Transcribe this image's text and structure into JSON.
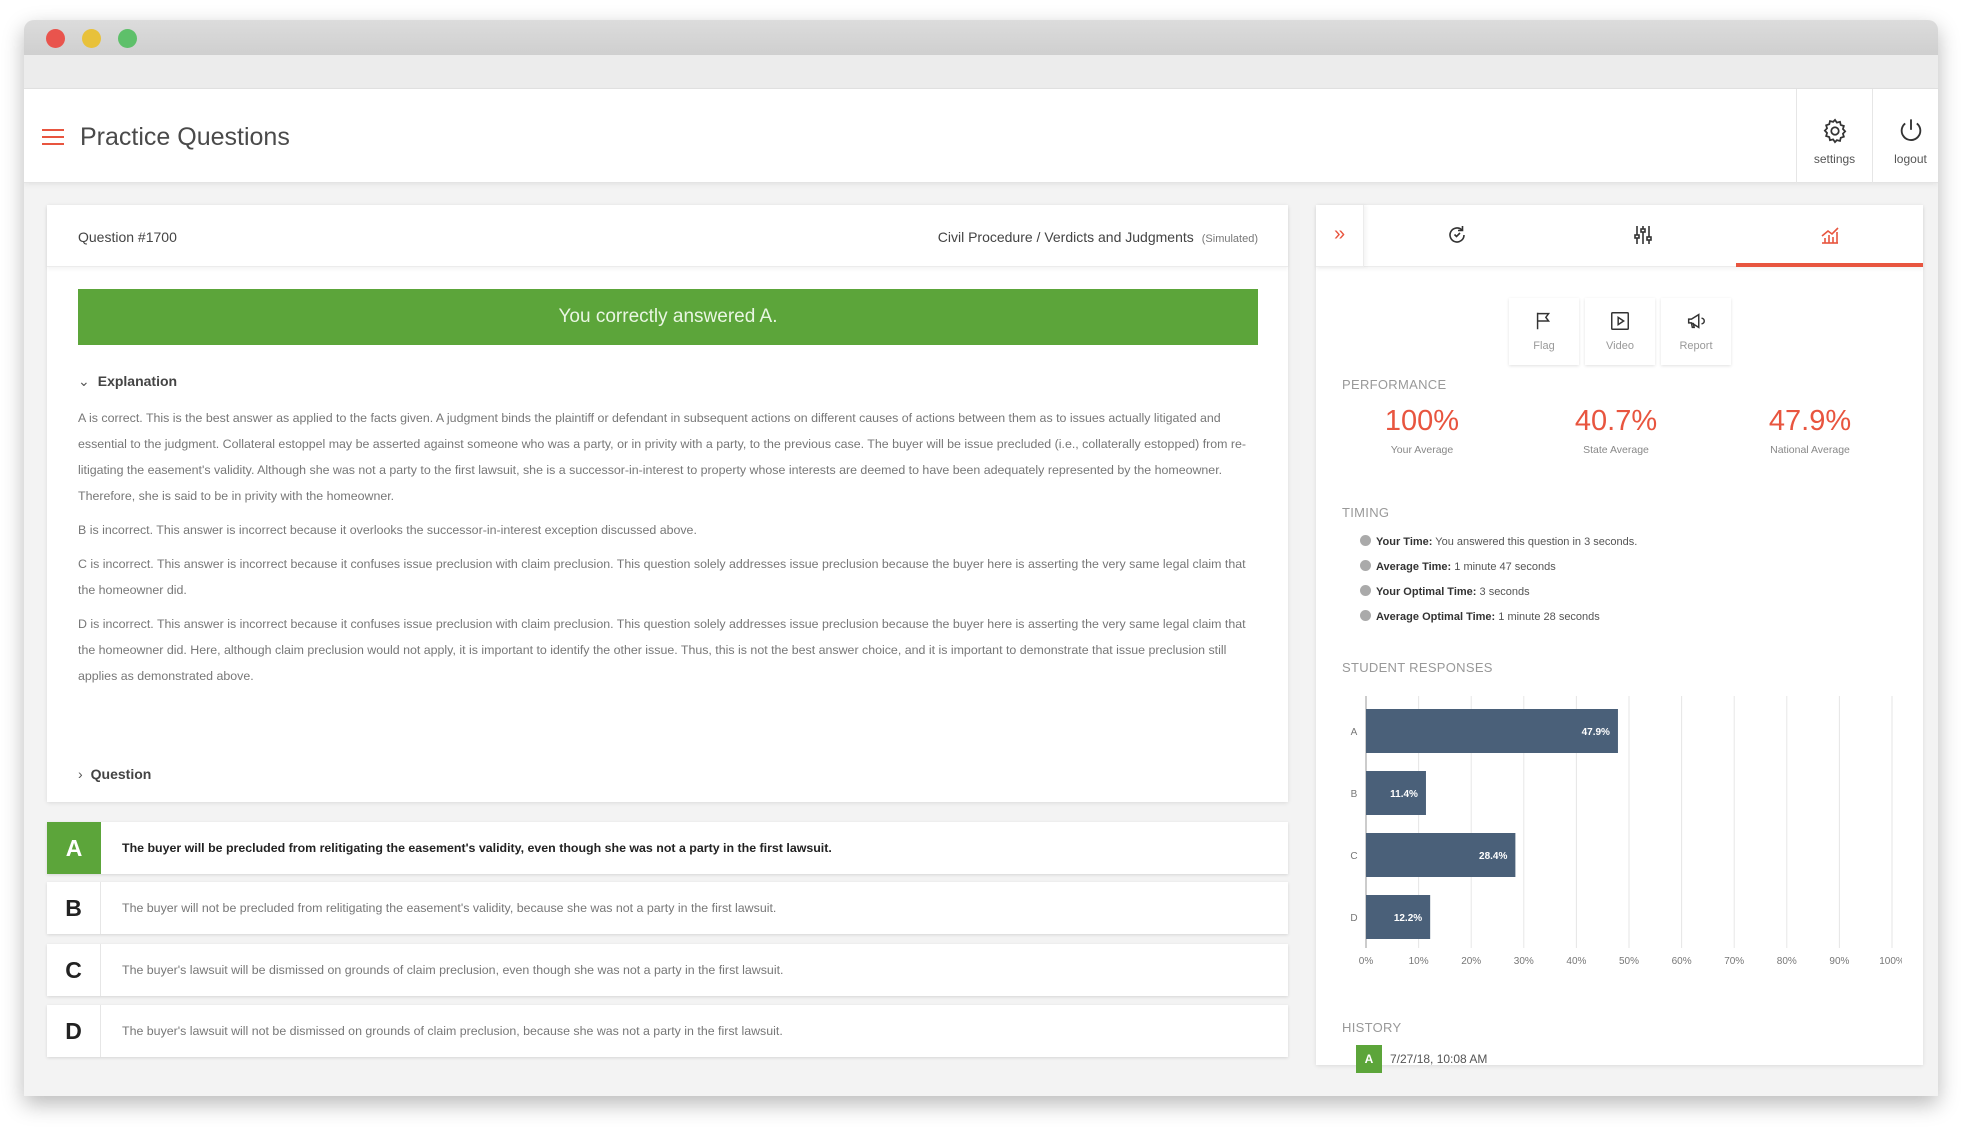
{
  "app": {
    "title": "Practice Questions"
  },
  "header": {
    "settings_label": "settings",
    "logout_label": "logout"
  },
  "question": {
    "number": "Question #1700",
    "category": "Civil Procedure / Verdicts and Judgments",
    "mode": "(Simulated)",
    "result_banner": "You correctly answered A.",
    "explanation_label": "Explanation",
    "question_label": "Question",
    "explanation": [
      "A is correct. This is the best answer as applied to the facts given. A judgment binds the plaintiff or defendant in subsequent actions on different causes of actions between them as to issues actually litigated and essential to the judgment. Collateral estoppel may be asserted against someone who was a party, or in privity with a party, to the previous case. The buyer will be issue precluded (i.e., collaterally estopped) from re-litigating the easement's validity. Although she was not a party to the first lawsuit, she is a successor-in-interest to property whose interests are deemed to have been adequately represented by the homeowner. Therefore, she is said to be in privity with the homeowner.",
      "B is incorrect. This answer is incorrect because it overlooks the successor-in-interest exception discussed above.",
      "C is incorrect. This answer is incorrect because it confuses issue preclusion with claim preclusion. This question solely addresses issue preclusion because the buyer here is asserting the very same legal claim that the homeowner did.",
      "D is incorrect. This answer is incorrect because it confuses issue preclusion with claim preclusion. This question solely addresses issue preclusion because the buyer here is asserting the very same legal claim that the homeowner did. Here, although claim preclusion would not apply, it is important to identify the other issue. Thus, this is not the best answer choice, and it is important to demonstrate that issue preclusion still applies as demonstrated above."
    ],
    "answers": [
      {
        "letter": "A",
        "text": "The buyer will be precluded from relitigating the easement's validity, even though she was not a party in the first lawsuit."
      },
      {
        "letter": "B",
        "text": "The buyer will not be precluded from relitigating the easement's validity, because she was not a party in the first lawsuit."
      },
      {
        "letter": "C",
        "text": "The buyer's lawsuit will be dismissed on grounds of claim preclusion, even though she was not a party in the first lawsuit."
      },
      {
        "letter": "D",
        "text": "The buyer's lawsuit will not be dismissed on grounds of claim preclusion, because she was not a party in the first lawsuit."
      }
    ]
  },
  "sidebar": {
    "actions": {
      "flag": "Flag",
      "video": "Video",
      "report": "Report"
    },
    "performance": {
      "label": "PERFORMANCE",
      "your_value": "100%",
      "your_caption": "Your Average",
      "state_value": "40.7%",
      "state_caption": "State Average",
      "national_value": "47.9%",
      "national_caption": "National Average"
    },
    "timing": {
      "label": "TIMING",
      "your_time_label": "Your Time:",
      "your_time_value": "You answered this question in 3 seconds.",
      "avg_time_label": "Average Time:",
      "avg_time_value": "1 minute 47 seconds",
      "optimal_label": "Your Optimal Time:",
      "optimal_value": "3 seconds",
      "avg_optimal_label": "Average Optimal Time:",
      "avg_optimal_value": "1 minute 28 seconds"
    },
    "responses_label": "STUDENT RESPONSES",
    "history": {
      "label": "HISTORY",
      "answer": "A",
      "time": "7/27/18, 10:08 AM"
    }
  },
  "colors": {
    "accent": "#e8553f",
    "correct": "#5ca53a",
    "bar": "#4a6079"
  },
  "chart_data": {
    "type": "bar",
    "orientation": "horizontal",
    "categories": [
      "A",
      "B",
      "C",
      "D"
    ],
    "values": [
      47.9,
      11.4,
      28.4,
      12.2
    ],
    "value_labels": [
      "47.9%",
      "11.4%",
      "28.4%",
      "12.2%"
    ],
    "xlim": [
      0,
      100
    ],
    "xticks": [
      "0%",
      "10%",
      "20%",
      "30%",
      "40%",
      "50%",
      "60%",
      "70%",
      "80%",
      "90%",
      "100%"
    ],
    "grid": true
  }
}
